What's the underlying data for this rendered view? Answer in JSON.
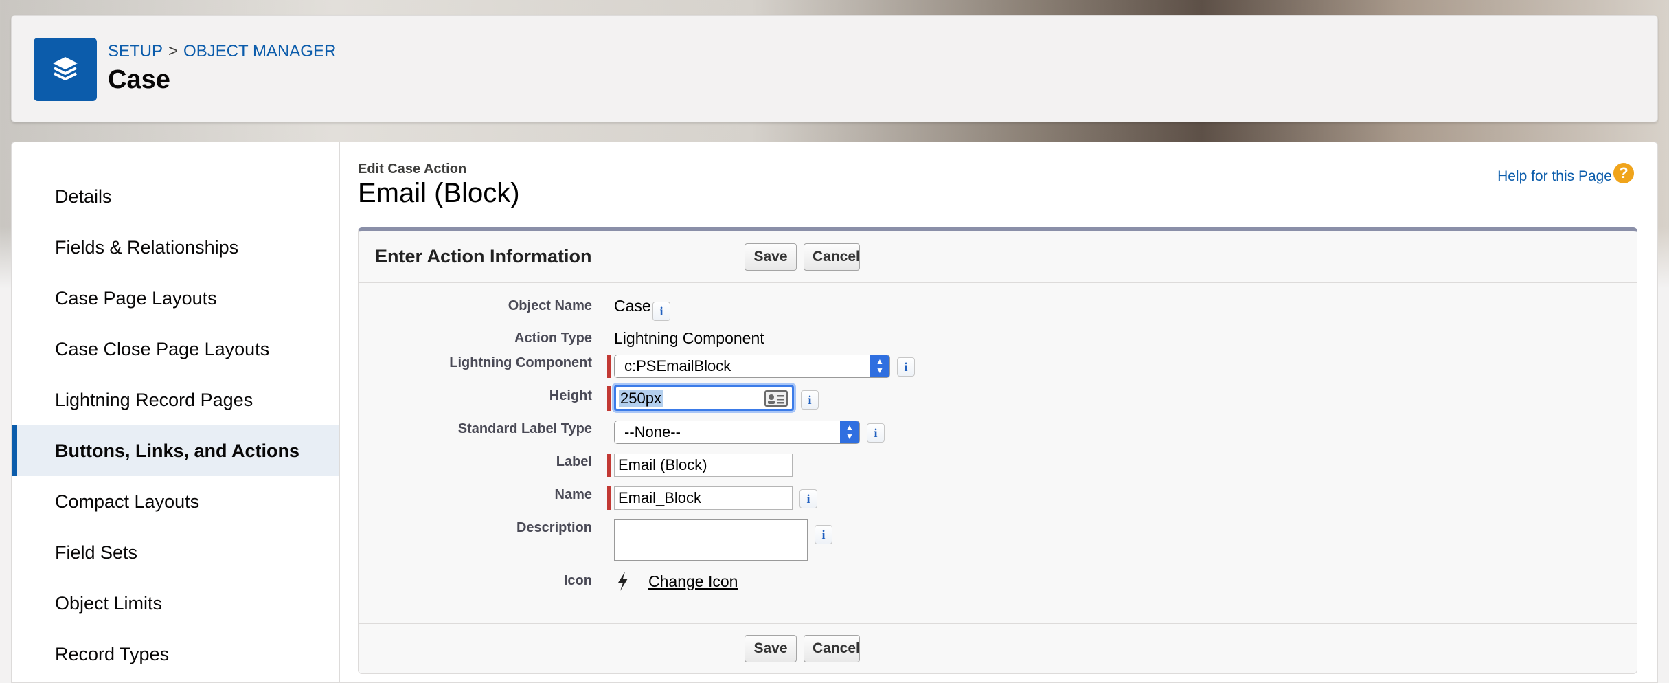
{
  "header": {
    "breadcrumb": [
      "SETUP",
      "OBJECT MANAGER"
    ],
    "breadcrumb_separator": ">",
    "title": "Case",
    "icon": "layers-icon",
    "icon_color": "#0c5cab"
  },
  "sidebar": {
    "items": [
      {
        "label": "Details"
      },
      {
        "label": "Fields & Relationships"
      },
      {
        "label": "Case Page Layouts"
      },
      {
        "label": "Case Close Page Layouts"
      },
      {
        "label": "Lightning Record Pages"
      },
      {
        "label": "Buttons, Links, and Actions",
        "active": true
      },
      {
        "label": "Compact Layouts"
      },
      {
        "label": "Field Sets"
      },
      {
        "label": "Object Limits"
      },
      {
        "label": "Record Types"
      }
    ]
  },
  "page": {
    "subtitle": "Edit Case Action",
    "title": "Email (Block)",
    "help_link": "Help for this Page",
    "help_icon": "question-icon"
  },
  "form": {
    "section_title": "Enter Action Information",
    "save_label": "Save",
    "cancel_label": "Cancel",
    "fields": {
      "object_name": {
        "label": "Object Name",
        "value": "Case"
      },
      "action_type": {
        "label": "Action Type",
        "value": "Lightning Component"
      },
      "lightning_component": {
        "label": "Lightning Component",
        "value": "c:PSEmailBlock"
      },
      "height": {
        "label": "Height",
        "value": "250px"
      },
      "standard_label_type": {
        "label": "Standard Label Type",
        "value": "--None--"
      },
      "label": {
        "label": "Label",
        "value": "Email (Block)"
      },
      "name": {
        "label": "Name",
        "value": "Email_Block"
      },
      "description": {
        "label": "Description",
        "value": ""
      },
      "icon": {
        "label": "Icon",
        "link": "Change Icon"
      }
    },
    "info_icon_glyph": "i"
  }
}
